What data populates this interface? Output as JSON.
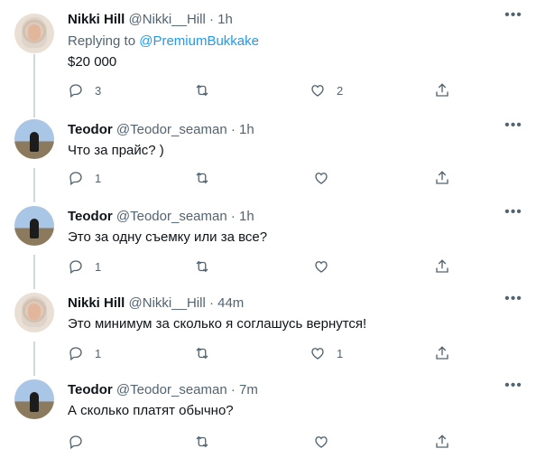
{
  "tweets": [
    {
      "name": "Nikki Hill",
      "handle": "@Nikki__Hill",
      "time": "· 1h",
      "replying_prefix": "Replying to ",
      "replying_to": "@PremiumBukkake",
      "text": "$20 000",
      "reply_count": "3",
      "retweet_count": "",
      "like_count": "2",
      "avatar": "nikki"
    },
    {
      "name": "Teodor",
      "handle": "@Teodor_seaman",
      "time": "· 1h",
      "text": "Что за прайс? )",
      "reply_count": "1",
      "retweet_count": "",
      "like_count": "",
      "avatar": "teodor"
    },
    {
      "name": "Teodor",
      "handle": "@Teodor_seaman",
      "time": "· 1h",
      "text": "Это за одну съемку или за все?",
      "reply_count": "1",
      "retweet_count": "",
      "like_count": "",
      "avatar": "teodor"
    },
    {
      "name": "Nikki Hill",
      "handle": "@Nikki__Hill",
      "time": "· 44m",
      "text": "Это минимум за сколько я соглашусь вернутся!",
      "reply_count": "1",
      "retweet_count": "",
      "like_count": "1",
      "avatar": "nikki"
    },
    {
      "name": "Teodor",
      "handle": "@Teodor_seaman",
      "time": "· 7m",
      "text": "А сколько платят обычно?",
      "reply_count": "",
      "retweet_count": "",
      "like_count": "",
      "avatar": "teodor"
    }
  ],
  "icons": {
    "reply": "reply-icon",
    "retweet": "retweet-icon",
    "like": "like-icon",
    "share": "share-icon",
    "more": "more-icon"
  },
  "colors": {
    "accent": "#1d9bf0",
    "muted": "#536471",
    "text": "#0f1419",
    "thread_line": "#cfd9de"
  }
}
